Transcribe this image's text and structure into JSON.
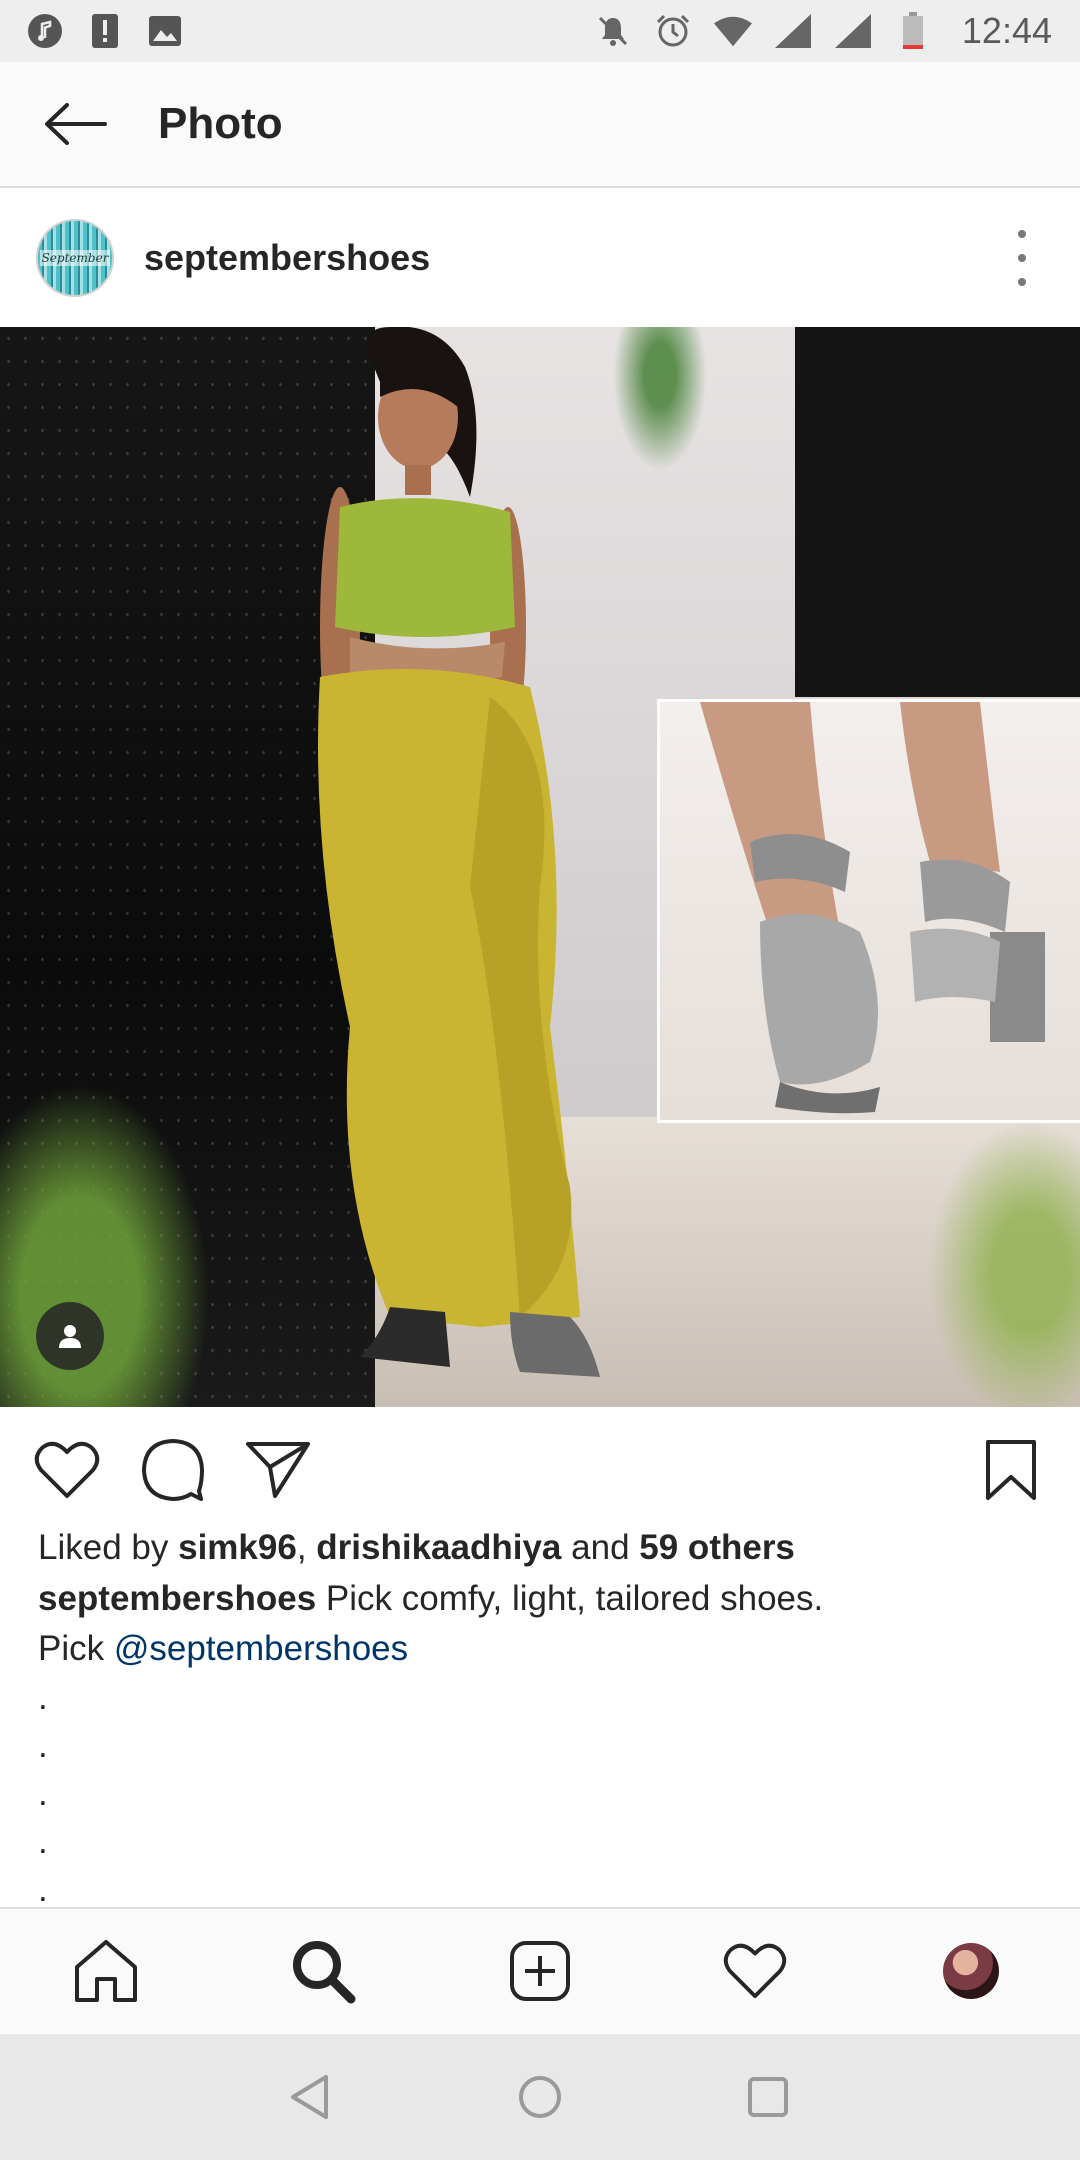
{
  "status_bar": {
    "time": "12:44",
    "left_icons": [
      "music-icon",
      "alert-icon",
      "image-icon"
    ],
    "right_icons": [
      "mute-icon",
      "alarm-icon",
      "wifi-icon",
      "signal-icon",
      "signal-icon",
      "battery-icon"
    ]
  },
  "app_bar": {
    "title": "Photo",
    "back_icon": "arrow-left-icon"
  },
  "post": {
    "username": "septembershoes",
    "avatar_text": "September",
    "more_icon": "more-vertical-icon"
  },
  "actions": {
    "like_icon": "heart-icon",
    "comment_icon": "comment-icon",
    "share_icon": "send-icon",
    "save_icon": "bookmark-icon"
  },
  "likes": {
    "prefix": "Liked by",
    "user1": "simk96",
    "sep": ",",
    "user2": "drishikaadhiya",
    "and": "and",
    "others": "59 others"
  },
  "caption": {
    "username": "septembershoes",
    "text": "Pick comfy, light, tailored shoes.",
    "line2_prefix": "Pick",
    "mention": "@septembershoes",
    "dots": [
      ".",
      ".",
      ".",
      ".",
      "."
    ]
  },
  "bottom_nav": {
    "items": [
      "home-icon",
      "search-icon",
      "add-post-icon",
      "activity-heart-icon",
      "profile-avatar"
    ]
  },
  "system_nav": {
    "items": [
      "back-triangle-icon",
      "home-circle-icon",
      "recents-square-icon"
    ]
  },
  "colors": {
    "mention": "#003569",
    "text": "#262626",
    "status_bar_bg": "#eeeeee",
    "system_nav_bg": "#e8e8e8"
  }
}
